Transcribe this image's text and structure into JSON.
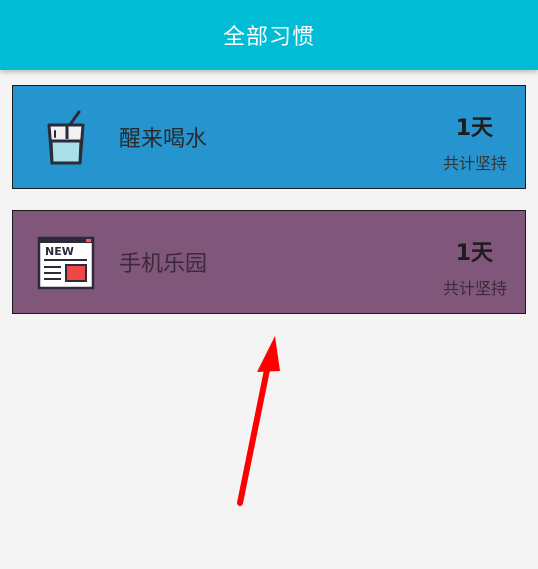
{
  "appbar": {
    "title": "全部习惯",
    "color": "#00bcd4"
  },
  "habits": [
    {
      "name": "醒来喝水",
      "count": "1天",
      "subtitle": "共计坚持",
      "icon": "drink-cup-icon",
      "bg_color": "#2694cf"
    },
    {
      "name": "手机乐园",
      "count": "1天",
      "subtitle": "共计坚持",
      "icon": "news-window-icon",
      "bg_color": "#80567b"
    }
  ],
  "annotation": {
    "arrow_color": "#ff0000",
    "arrow_icon": "red-arrow-annotation"
  }
}
